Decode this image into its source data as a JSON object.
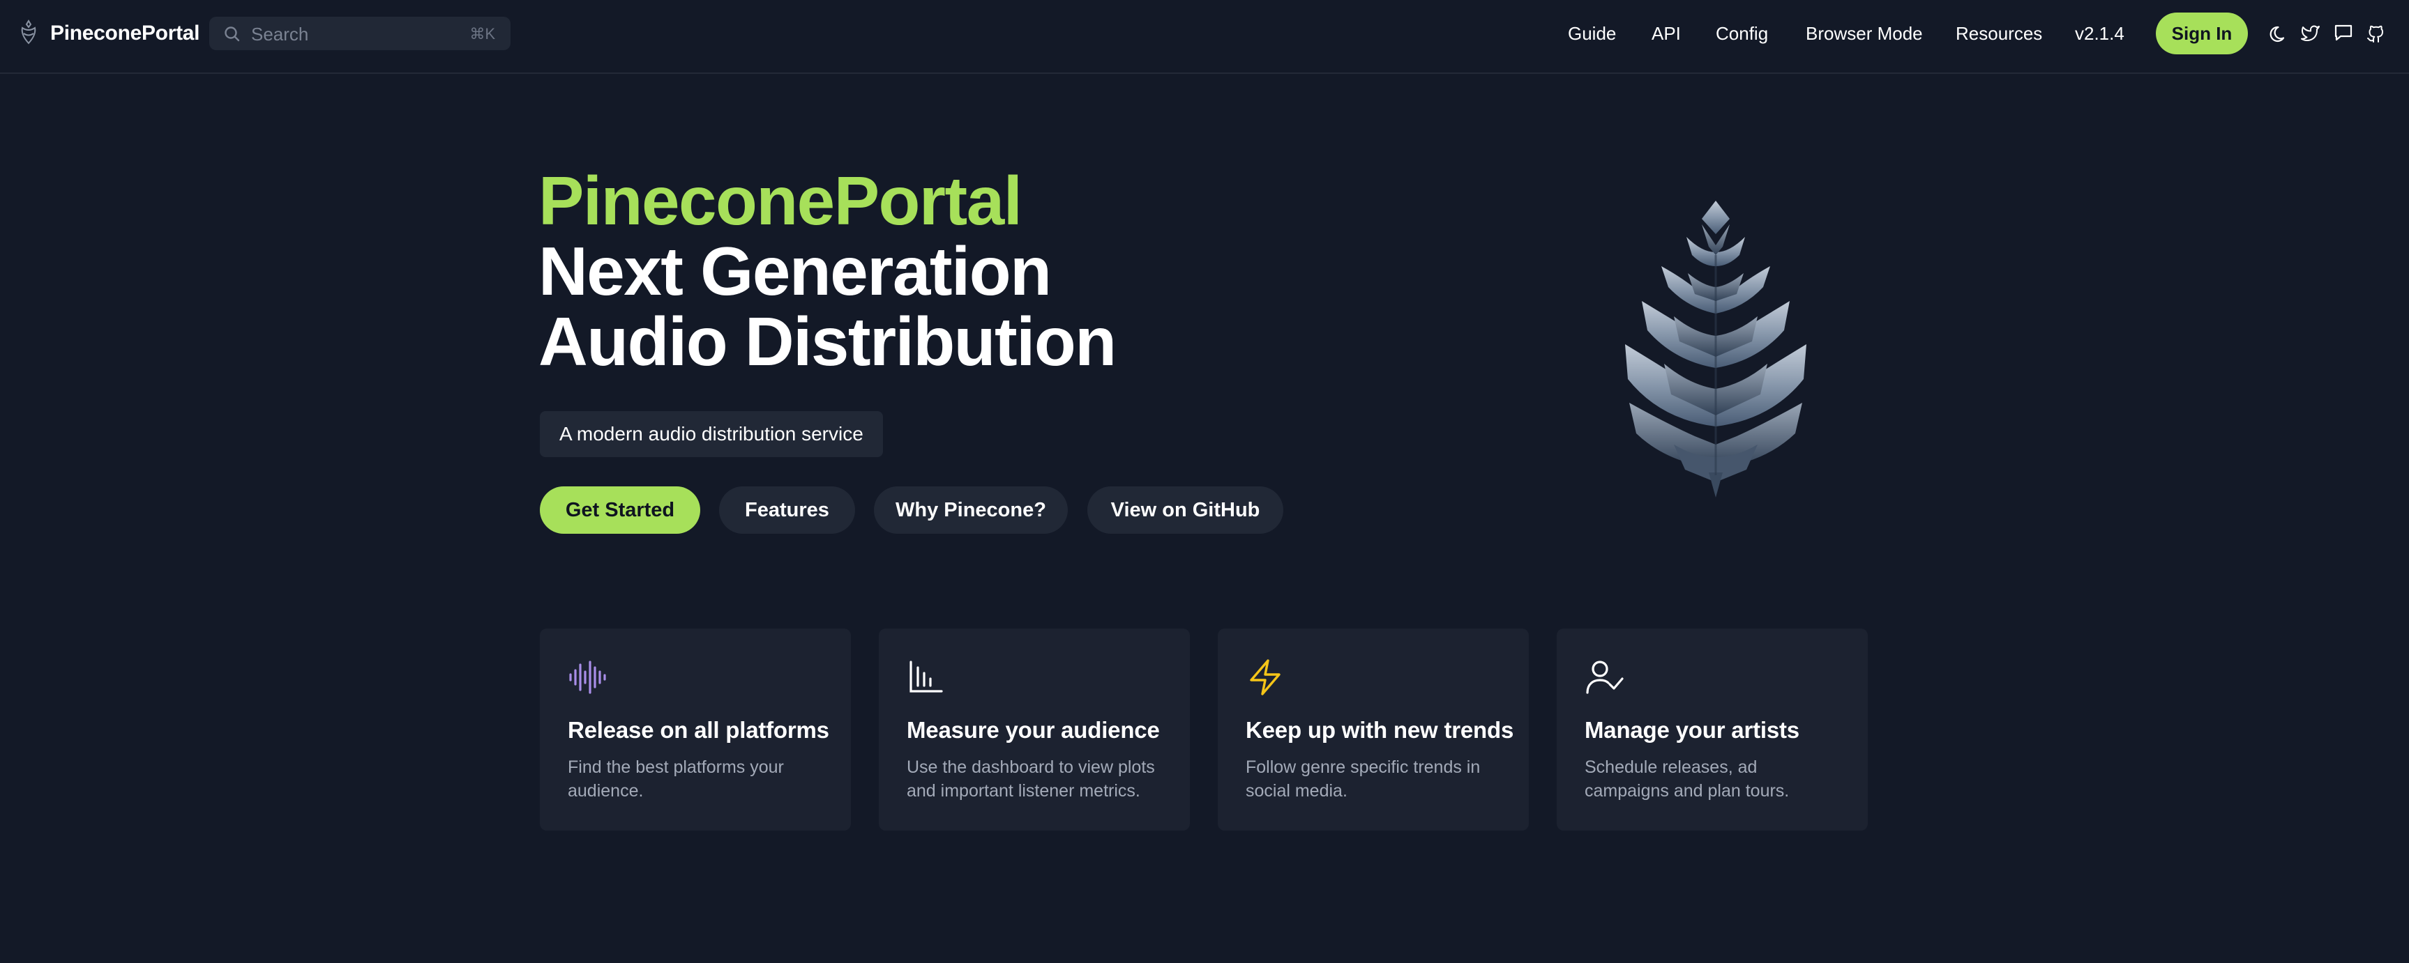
{
  "nav": {
    "brand": "PineconePortal",
    "search": {
      "placeholder": "Search",
      "shortcut": "⌘K"
    },
    "links": [
      "Guide",
      "API",
      "Config",
      "Browser Mode",
      "Resources",
      "v2.1.4"
    ],
    "sign_in": "Sign In",
    "icons": [
      "moon-icon",
      "twitter-icon",
      "chat-icon",
      "github-icon"
    ]
  },
  "hero": {
    "title_accent": "PineconePortal",
    "title_line2": "Next Generation",
    "title_line3": "Audio Distribution",
    "tagline": "A modern audio distribution service",
    "buttons": [
      "Get Started",
      "Features",
      "Why Pinecone?",
      "View on GitHub"
    ]
  },
  "features": [
    {
      "icon": "audio-wave-icon",
      "title": "Release on all platforms",
      "description": "Find the best platforms your audience."
    },
    {
      "icon": "bar-chart-icon",
      "title": "Measure your audience",
      "description": "Use the dashboard to view plots and important listener metrics."
    },
    {
      "icon": "lightning-icon",
      "title": "Keep up with new trends",
      "description": "Follow genre specific trends in social media."
    },
    {
      "icon": "user-check-icon",
      "title": "Manage your artists",
      "description": "Schedule releases, ad campaigns and plan tours."
    }
  ],
  "colors": {
    "background": "#131927",
    "accent": "#a7e05a",
    "card": "#1c2230",
    "muted_text": "#a3aab8"
  }
}
